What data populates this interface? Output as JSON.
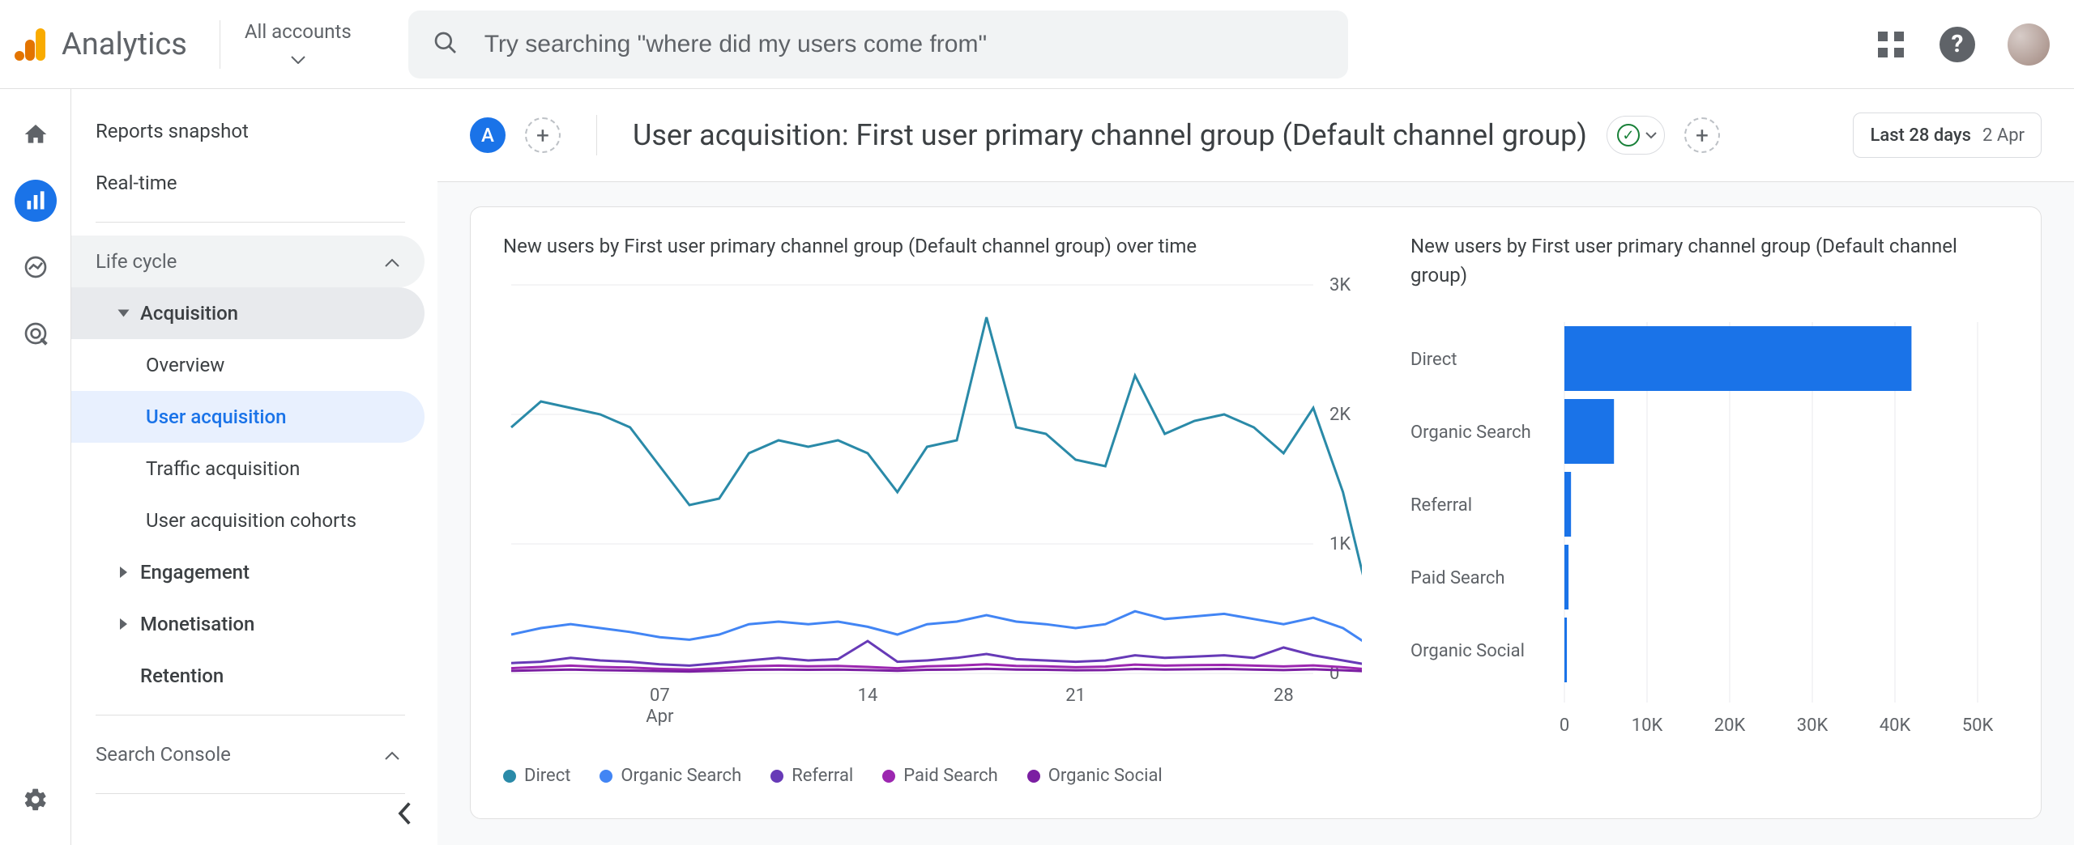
{
  "brand": {
    "name": "Analytics"
  },
  "account_switcher": {
    "label": "All accounts"
  },
  "search": {
    "placeholder": "Try searching \"where did my users come from\""
  },
  "nav": {
    "reports_snapshot": "Reports snapshot",
    "realtime": "Real-time",
    "life_cycle": "Life cycle",
    "acquisition": "Acquisition",
    "overview": "Overview",
    "user_acquisition": "User acquisition",
    "traffic_acquisition": "Traffic acquisition",
    "user_acq_cohorts": "User acquisition cohorts",
    "engagement": "Engagement",
    "monetisation": "Monetisation",
    "retention": "Retention",
    "search_console": "Search Console"
  },
  "page": {
    "avatar_letter": "A",
    "title": "User acquisition: First user primary channel group (Default channel group)",
    "date_label": "Last 28 days",
    "date_range": "2 Apr"
  },
  "colors": {
    "direct": "#2a8aa8",
    "organic_search": "#4285f4",
    "referral": "#673ab7",
    "paid_search": "#9c27b0",
    "organic_social": "#7b1fa2",
    "bar": "#1a73e8"
  },
  "chart_data": [
    {
      "type": "line",
      "title": "New users by First user primary channel group (Default channel group) over time",
      "xlabel": "Apr",
      "ylabel": "",
      "ylim": [
        0,
        3000
      ],
      "yticks": [
        0,
        1000,
        2000,
        3000
      ],
      "ytick_labels": [
        "0",
        "1K",
        "2K",
        "3K"
      ],
      "xticks": [
        "07",
        "14",
        "21",
        "28"
      ],
      "x": [
        2,
        3,
        4,
        5,
        6,
        7,
        8,
        9,
        10,
        11,
        12,
        13,
        14,
        15,
        16,
        17,
        18,
        19,
        20,
        21,
        22,
        23,
        24,
        25,
        26,
        27,
        28,
        29
      ],
      "series": [
        {
          "name": "Direct",
          "color_key": "direct",
          "values": [
            1900,
            2100,
            2050,
            2000,
            1900,
            1600,
            1300,
            1350,
            1700,
            1800,
            1750,
            1800,
            1700,
            1400,
            1750,
            1800,
            2750,
            1900,
            1850,
            1650,
            1600,
            2300,
            1850,
            1950,
            2000,
            1900,
            1700,
            2050,
            1400,
            450
          ]
        },
        {
          "name": "Organic Search",
          "color_key": "organic_search",
          "values": [
            300,
            350,
            380,
            350,
            320,
            280,
            260,
            300,
            380,
            400,
            380,
            400,
            360,
            300,
            380,
            400,
            450,
            400,
            380,
            350,
            380,
            480,
            420,
            440,
            460,
            420,
            380,
            430,
            350,
            200
          ]
        },
        {
          "name": "Referral",
          "color_key": "referral",
          "values": [
            80,
            90,
            120,
            100,
            90,
            70,
            60,
            80,
            100,
            120,
            100,
            110,
            250,
            90,
            100,
            120,
            150,
            110,
            100,
            90,
            100,
            140,
            120,
            130,
            140,
            120,
            200,
            140,
            100,
            60
          ]
        },
        {
          "name": "Paid Search",
          "color_key": "paid_search",
          "values": [
            40,
            50,
            60,
            50,
            45,
            35,
            30,
            40,
            55,
            60,
            55,
            58,
            50,
            40,
            55,
            60,
            70,
            58,
            55,
            48,
            52,
            68,
            60,
            64,
            66,
            60,
            54,
            62,
            48,
            28
          ]
        },
        {
          "name": "Organic Social",
          "color_key": "organic_social",
          "values": [
            20,
            25,
            30,
            25,
            22,
            18,
            15,
            20,
            28,
            30,
            28,
            30,
            26,
            20,
            28,
            30,
            36,
            30,
            28,
            24,
            26,
            34,
            30,
            32,
            34,
            30,
            26,
            32,
            24,
            14
          ]
        }
      ]
    },
    {
      "type": "bar",
      "title": "New users by First user primary channel group (Default channel group)",
      "orientation": "horizontal",
      "xlim": [
        0,
        50000
      ],
      "xticks": [
        0,
        10000,
        20000,
        30000,
        40000,
        50000
      ],
      "xtick_labels": [
        "0",
        "10K",
        "20K",
        "30K",
        "40K",
        "50K"
      ],
      "categories": [
        "Direct",
        "Organic Search",
        "Referral",
        "Paid Search",
        "Organic Social"
      ],
      "values": [
        42000,
        6000,
        800,
        500,
        300
      ]
    }
  ]
}
